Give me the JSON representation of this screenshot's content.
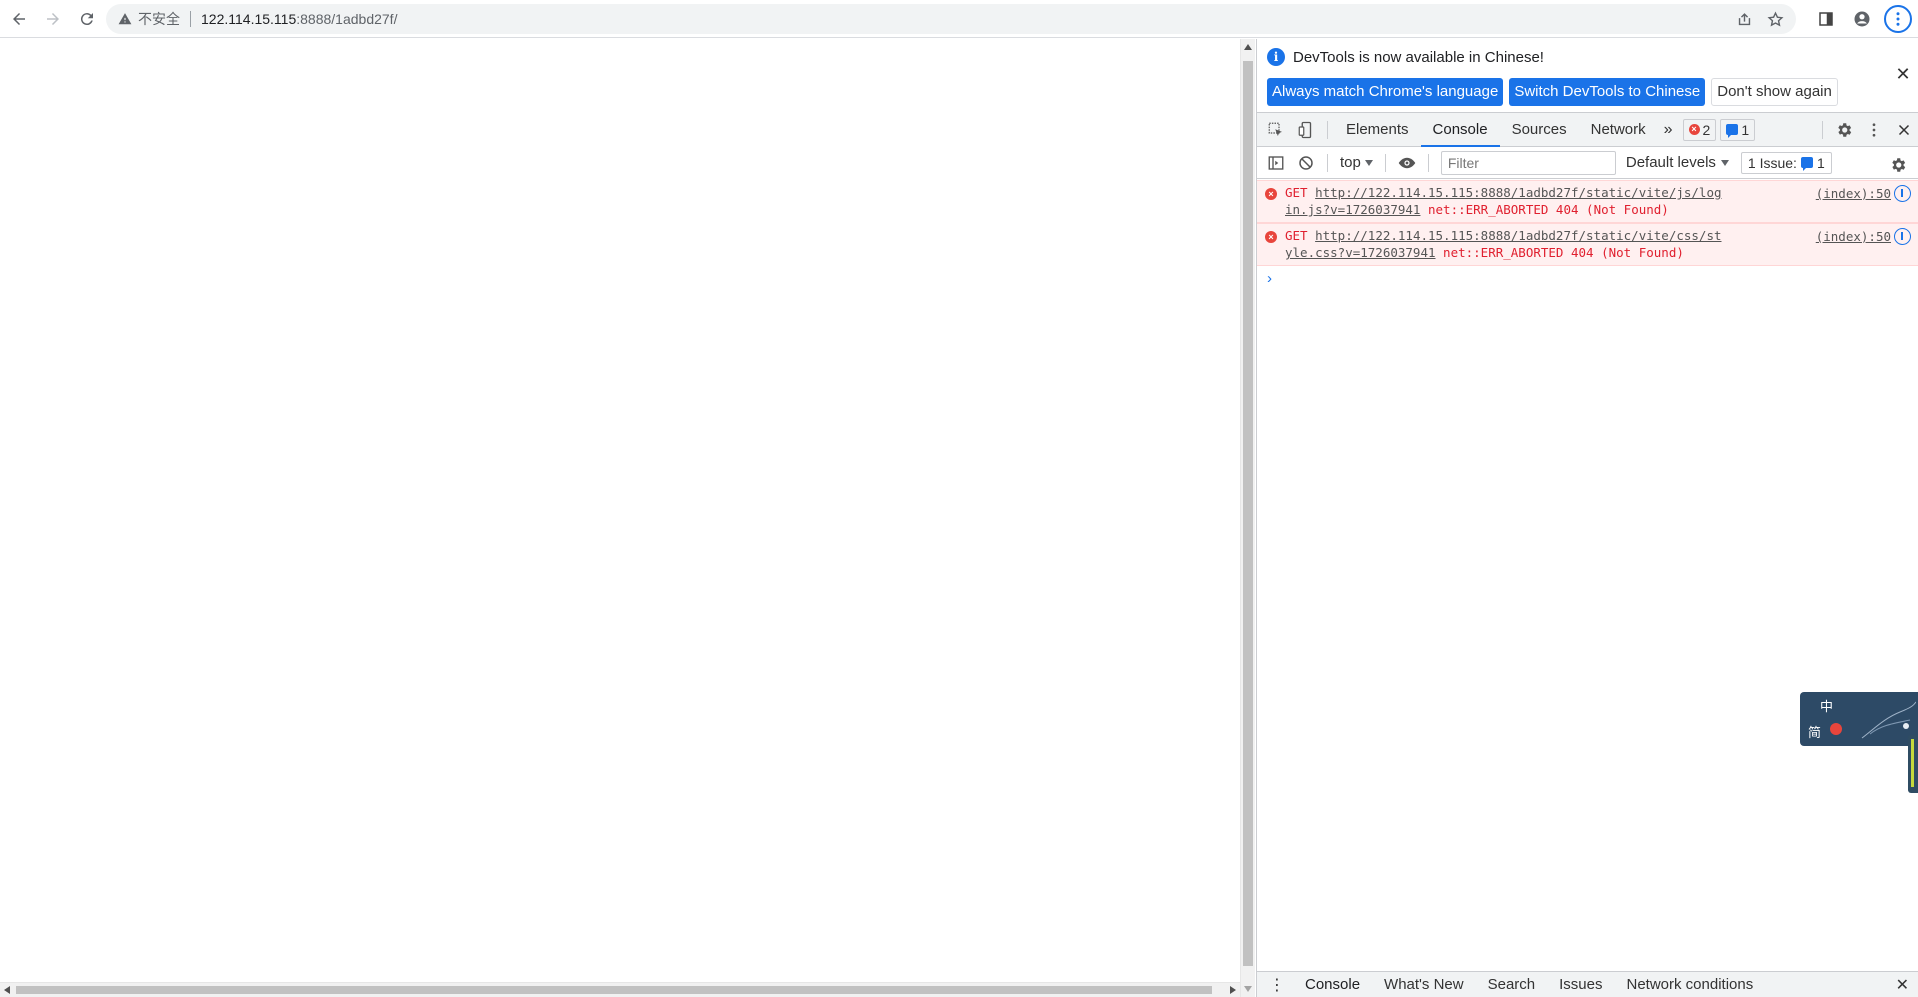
{
  "browser": {
    "insecure_label": "不安全",
    "url_host": "122.114.15.115",
    "url_rest": ":8888/1adbd27f/"
  },
  "devtools": {
    "infobar": {
      "message": "DevTools is now available in Chinese!",
      "btn_match": "Always match Chrome's language",
      "btn_switch": "Switch DevTools to Chinese",
      "btn_dismiss": "Don't show again"
    },
    "tabs": [
      "Elements",
      "Console",
      "Sources",
      "Network"
    ],
    "active_tab": "Console",
    "error_count": "2",
    "message_count": "1",
    "toolbar": {
      "context": "top",
      "filter_placeholder": "Filter",
      "levels": "Default levels",
      "issues_label": "1 Issue:",
      "issues_count": "1"
    },
    "logs": [
      {
        "method": "GET",
        "url": "http://122.114.15.115:8888/1adbd27f/static/vite/js/login.js?v=1726037941",
        "url_line1": "http://122.114.15.115:8888/1adbd27f/static/vite/js/log",
        "url_line2": "in.js?v=1726037941",
        "error": "net::ERR_ABORTED 404 (Not Found)",
        "source": "(index):50"
      },
      {
        "method": "GET",
        "url": "http://122.114.15.115:8888/1adbd27f/static/vite/css/style.css?v=1726037941",
        "url_line1": "http://122.114.15.115:8888/1adbd27f/static/vite/css/st",
        "url_line2": "yle.css?v=1726037941",
        "error": "net::ERR_ABORTED 404 (Not Found)",
        "source": "(index):50"
      }
    ],
    "drawer_tabs": [
      "Console",
      "What's New",
      "Search",
      "Issues",
      "Network conditions"
    ]
  },
  "ime": {
    "char_top": "中",
    "char_bottom": "简"
  },
  "colors": {
    "accent": "#1a73e8",
    "error": "#e8453c"
  }
}
